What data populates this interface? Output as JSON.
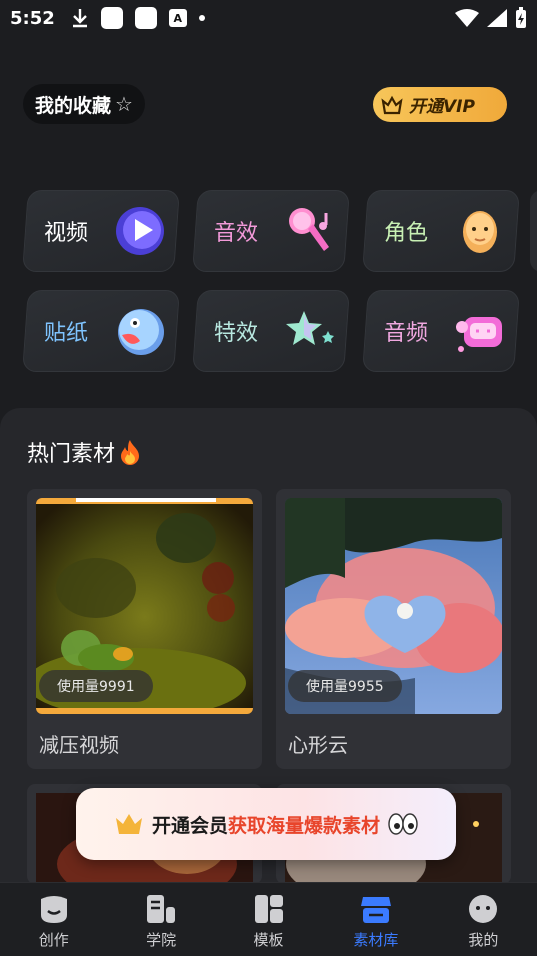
{
  "status": {
    "time": "5:52"
  },
  "header": {
    "favorites_label": "我的收藏",
    "vip_label": "开通VIP"
  },
  "categories": [
    {
      "label": "视频",
      "icon": "play-icon",
      "color": "#ffffff"
    },
    {
      "label": "音效",
      "icon": "microphone-icon",
      "color": "#f29ad9"
    },
    {
      "label": "角色",
      "icon": "face-icon",
      "color": "#c8f0b4"
    },
    {
      "label": "贴纸",
      "icon": "bird-sticker-icon",
      "color": "#7fc4ff"
    },
    {
      "label": "特效",
      "icon": "star-icon",
      "color": "#b8e8e0"
    },
    {
      "label": "音频",
      "icon": "tv-audio-icon",
      "color": "#f0a8e0"
    }
  ],
  "hot": {
    "title": "热门素材",
    "items": [
      {
        "name": "减压视频",
        "usage": "使用量9991"
      },
      {
        "name": "心形云",
        "usage": "使用量9955"
      }
    ]
  },
  "promo": {
    "prefix": "开通会员",
    "highlight": "获取海量爆款素材"
  },
  "tabs": [
    {
      "label": "创作",
      "icon": "create-icon"
    },
    {
      "label": "学院",
      "icon": "academy-icon"
    },
    {
      "label": "模板",
      "icon": "template-icon"
    },
    {
      "label": "素材库",
      "icon": "store-icon",
      "active": true
    },
    {
      "label": "我的",
      "icon": "profile-icon"
    }
  ],
  "colors": {
    "accent": "#3b7bff",
    "vip": "#f7c65a",
    "promo_highlight": "#e8452b"
  }
}
